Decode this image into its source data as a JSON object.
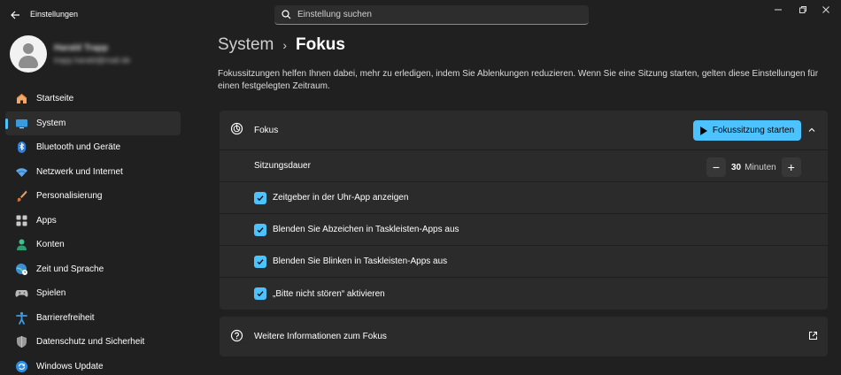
{
  "app": {
    "title": "Einstellungen"
  },
  "search": {
    "placeholder": "Einstellung suchen"
  },
  "profile": {
    "name": "Harald Trapp",
    "email": "trapp.harald@mail.de"
  },
  "sidebar": {
    "items": [
      {
        "label": "Startseite",
        "icon": "home-icon",
        "active": false
      },
      {
        "label": "System",
        "icon": "system-icon",
        "active": true
      },
      {
        "label": "Bluetooth und Geräte",
        "icon": "bluetooth-icon",
        "active": false
      },
      {
        "label": "Netzwerk und Internet",
        "icon": "network-icon",
        "active": false
      },
      {
        "label": "Personalisierung",
        "icon": "brush-icon",
        "active": false
      },
      {
        "label": "Apps",
        "icon": "apps-icon",
        "active": false
      },
      {
        "label": "Konten",
        "icon": "accounts-icon",
        "active": false
      },
      {
        "label": "Zeit und Sprache",
        "icon": "globe-clock-icon",
        "active": false
      },
      {
        "label": "Spielen",
        "icon": "gamepad-icon",
        "active": false
      },
      {
        "label": "Barrierefreiheit",
        "icon": "accessibility-icon",
        "active": false
      },
      {
        "label": "Datenschutz und Sicherheit",
        "icon": "shield-icon",
        "active": false
      },
      {
        "label": "Windows Update",
        "icon": "update-icon",
        "active": false
      }
    ]
  },
  "breadcrumb": {
    "parent": "System",
    "separator": "›",
    "current": "Fokus"
  },
  "description": "Fokussitzungen helfen Ihnen dabei, mehr zu erledigen, indem Sie Ablenkungen reduzieren. Wenn Sie eine Sitzung starten, gelten diese Einstellungen für einen festgelegten Zeitraum.",
  "focus_card": {
    "title": "Fokus",
    "start_button": "Fokussitzung starten",
    "duration": {
      "label": "Sitzungsdauer",
      "value": "30",
      "unit": "Minuten",
      "minus": "−",
      "plus": "+"
    },
    "options": [
      {
        "label": "Zeitgeber in der Uhr-App anzeigen",
        "checked": true
      },
      {
        "label": "Blenden Sie Abzeichen in Taskleisten-Apps aus",
        "checked": true
      },
      {
        "label": "Blenden Sie Blinken in Taskleisten-Apps aus",
        "checked": true
      },
      {
        "label": "„Bitte nicht stören“ aktivieren",
        "checked": true
      }
    ]
  },
  "info_card": {
    "title": "Weitere Informationen zum Fokus"
  },
  "colors": {
    "accent": "#4cc2ff",
    "background": "#202020",
    "card": "#2b2b2b"
  }
}
